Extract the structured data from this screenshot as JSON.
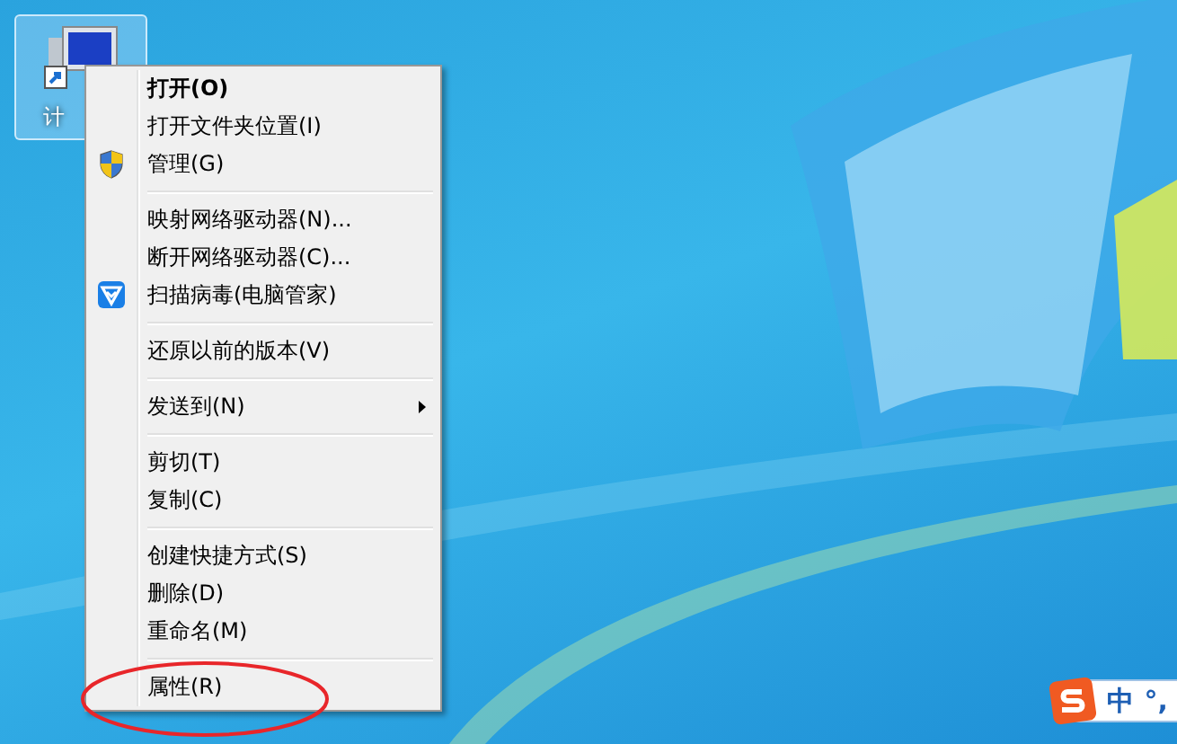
{
  "desktop_icon": {
    "label": "计",
    "selected": true
  },
  "context_menu": {
    "groups": [
      [
        {
          "label": "打开(O)",
          "bold": true,
          "kind": "plain"
        },
        {
          "label": "打开文件夹位置(I)",
          "bold": false,
          "kind": "plain"
        },
        {
          "label": "管理(G)",
          "bold": false,
          "kind": "shield"
        }
      ],
      [
        {
          "label": "映射网络驱动器(N)...",
          "bold": false,
          "kind": "plain"
        },
        {
          "label": "断开网络驱动器(C)...",
          "bold": false,
          "kind": "plain"
        },
        {
          "label": "扫描病毒(电脑管家)",
          "bold": false,
          "kind": "guard"
        }
      ],
      [
        {
          "label": "还原以前的版本(V)",
          "bold": false,
          "kind": "plain"
        }
      ],
      [
        {
          "label": "发送到(N)",
          "bold": false,
          "kind": "submenu"
        }
      ],
      [
        {
          "label": "剪切(T)",
          "bold": false,
          "kind": "plain"
        },
        {
          "label": "复制(C)",
          "bold": false,
          "kind": "plain"
        }
      ],
      [
        {
          "label": "创建快捷方式(S)",
          "bold": false,
          "kind": "plain"
        },
        {
          "label": "删除(D)",
          "bold": false,
          "kind": "plain"
        },
        {
          "label": "重命名(M)",
          "bold": false,
          "kind": "plain"
        }
      ],
      [
        {
          "label": "属性(R)",
          "bold": false,
          "kind": "plain"
        }
      ]
    ]
  },
  "ime_bar": {
    "mode": "中",
    "punctuation": "°,"
  }
}
